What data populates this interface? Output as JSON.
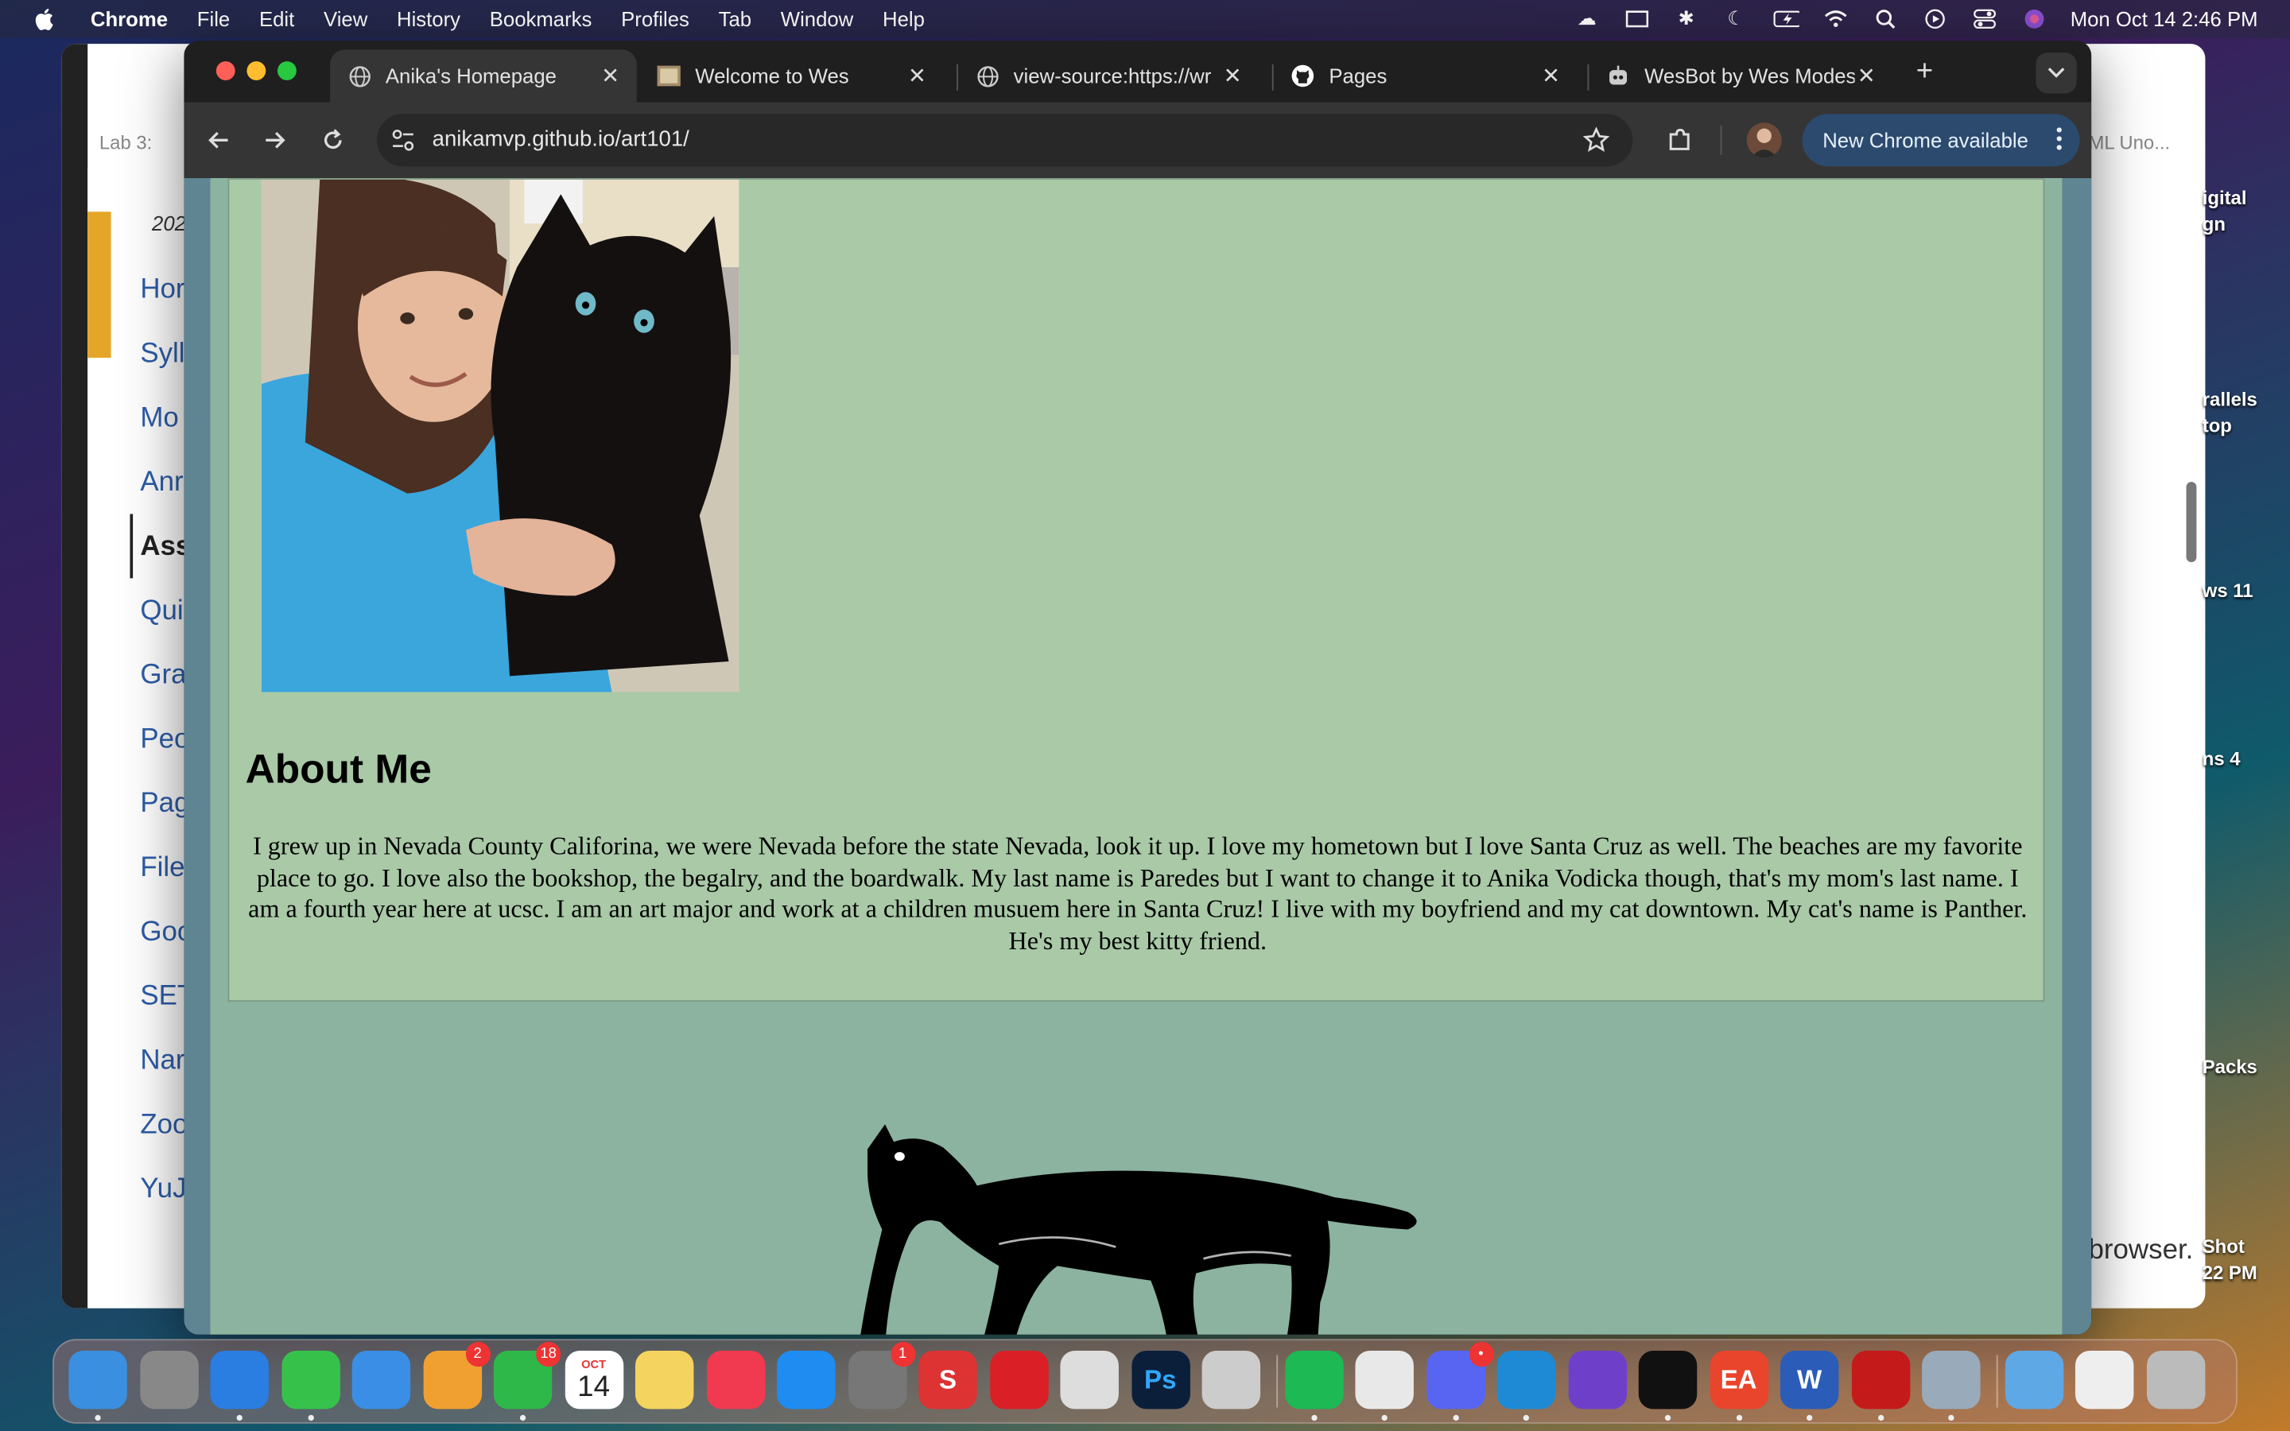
{
  "menubar": {
    "app_name": "Chrome",
    "items": [
      "File",
      "Edit",
      "View",
      "History",
      "Bookmarks",
      "Profiles",
      "Tab",
      "Window",
      "Help"
    ],
    "clock": "Mon Oct 14  2:46 PM",
    "status_icons": [
      "creative-cloud-icon",
      "display-icon",
      "bluetooth-icon",
      "moon-icon",
      "battery-icon",
      "wifi-icon",
      "search-icon",
      "play-icon",
      "control-center-icon",
      "siri-icon"
    ]
  },
  "background_window": {
    "tab_label": "Lab 3:",
    "year_fragment": "202",
    "nav_items": [
      "Hor",
      "Syll",
      "Mo",
      "Anr",
      "Ass",
      "Qui",
      "Gra",
      "Peo",
      "Pag",
      "File",
      "Goo",
      "SET",
      "Nar",
      "Zoo",
      "YuJ"
    ],
    "active_nav": "Ass",
    "right_tab_fragment": "ML Uno...",
    "browser_text": "browser."
  },
  "desktop_labels": [
    "igital",
    "gn",
    "rallels",
    "top",
    "ws 11",
    "ns 4",
    "Packs",
    "Shot",
    "22 PM"
  ],
  "browser": {
    "tabs": [
      {
        "title": "Anika's Homepage",
        "icon": "globe-icon",
        "active": true
      },
      {
        "title": "Welcome to Wes",
        "icon": "page-thumbnail-icon",
        "active": false
      },
      {
        "title": "view-source:https://wr",
        "icon": "globe-icon",
        "active": false
      },
      {
        "title": "Pages",
        "icon": "github-icon",
        "active": false
      },
      {
        "title": "WesBot by Wes Modes",
        "icon": "bot-icon",
        "active": false
      }
    ],
    "new_tab_label": "+",
    "url": "anikamvp.github.io/art101/",
    "update_button": "New Chrome available"
  },
  "page": {
    "photo_alt": "Anika holding a black cat",
    "about_heading": "About Me",
    "about_text": "I grew up in Nevada County Califorina, we were Nevada before the state Nevada, look it up. I love my hometown but I love Santa Cruz as well. The beaches are my favorite place to go. I love also the bookshop, the begalry, and the boardwalk. My last name is Paredes but I want to change it to Anika Vodicka though, that's my mom's last name. I am a fourth year here at ucsc. I am an art major and work at a children musuem here in Santa Cruz! I live with my boyfriend and my cat downtown. My cat's name is Panther. He's my best kitty friend.",
    "colors": {
      "card": "#a9c9a7",
      "page": "#8bb3a0",
      "frame": "#5f8592"
    }
  },
  "dock": {
    "apps": [
      {
        "name": "finder-icon",
        "color": "#3b8fe0"
      },
      {
        "name": "launchpad-icon",
        "color": "#888"
      },
      {
        "name": "safari-icon",
        "color": "#2a7de1"
      },
      {
        "name": "messages-icon",
        "color": "#36c24a"
      },
      {
        "name": "mail-icon",
        "color": "#3a8ee6"
      },
      {
        "name": "photos-icon",
        "color": "#f0a030",
        "badge": "2"
      },
      {
        "name": "facetime-icon",
        "color": "#2fb84a",
        "badge": "18"
      },
      {
        "name": "calendar-icon",
        "color": "#ffffff",
        "label": "14",
        "month": "OCT"
      },
      {
        "name": "notes-icon",
        "color": "#f4d35e"
      },
      {
        "name": "music-icon",
        "color": "#f1394f"
      },
      {
        "name": "app-store-icon",
        "color": "#1f8cf2"
      },
      {
        "name": "system-settings-icon",
        "color": "#777",
        "badge": "1"
      },
      {
        "name": "scrivener-icon",
        "color": "#d33",
        "label": "S"
      },
      {
        "name": "creative-cloud-icon",
        "color": "#da1f26"
      },
      {
        "name": "minecraft-icon",
        "color": "#ddd"
      },
      {
        "name": "photoshop-icon",
        "color": "#0b1f3a",
        "label": "Ps"
      },
      {
        "name": "roblox-icon",
        "color": "#ccc"
      },
      {
        "name": "spotify-icon",
        "color": "#1db954"
      },
      {
        "name": "chrome-icon",
        "color": "#e8e8e8"
      },
      {
        "name": "discord-icon",
        "color": "#5865f2",
        "badge": "•"
      },
      {
        "name": "vscode-icon",
        "color": "#1e8ad6"
      },
      {
        "name": "github-desktop-icon",
        "color": "#6e40c9"
      },
      {
        "name": "capcut-icon",
        "color": "#111"
      },
      {
        "name": "ea-icon",
        "color": "#e8452c",
        "label": "EA"
      },
      {
        "name": "word-icon",
        "color": "#2b5cb8",
        "label": "W"
      },
      {
        "name": "acrobat-icon",
        "color": "#c41a1a"
      },
      {
        "name": "preview-icon",
        "color": "#9ab"
      },
      {
        "name": "applications-folder-icon",
        "color": "#5fa8e6"
      },
      {
        "name": "pdf-document-icon",
        "color": "#eee"
      },
      {
        "name": "trash-icon",
        "color": "#bbb"
      }
    ]
  }
}
